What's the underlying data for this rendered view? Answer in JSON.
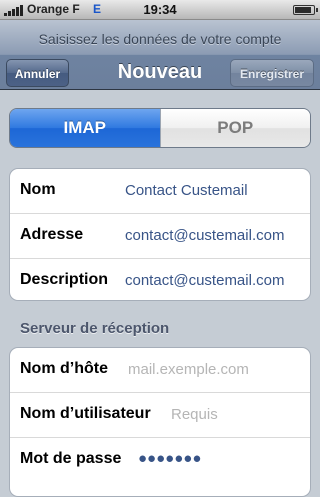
{
  "status_bar": {
    "carrier": "Orange F",
    "network": "E",
    "time": "19:34",
    "battery_level": 0.9
  },
  "navbar": {
    "prompt": "Saisissez les données de votre compte",
    "title": "Nouveau",
    "cancel_label": "Annuler",
    "save_label": "Enregistrer"
  },
  "segmented": {
    "options": [
      "IMAP",
      "POP"
    ],
    "selected": "IMAP",
    "accent": "#2f79e0"
  },
  "account": {
    "rows": [
      {
        "label": "Nom",
        "value": "Contact Custemail"
      },
      {
        "label": "Adresse",
        "value": "contact@custemail.com"
      },
      {
        "label": "Description",
        "value": "contact@custemail.com"
      }
    ]
  },
  "incoming": {
    "header": "Serveur de réception",
    "host_label": "Nom d’hôte",
    "host_placeholder": "mail.exemple.com",
    "user_label": "Nom d’utilisateur",
    "user_placeholder": "Requis",
    "password_label": "Mot de passe",
    "password_mask": "●●●●●●●"
  }
}
